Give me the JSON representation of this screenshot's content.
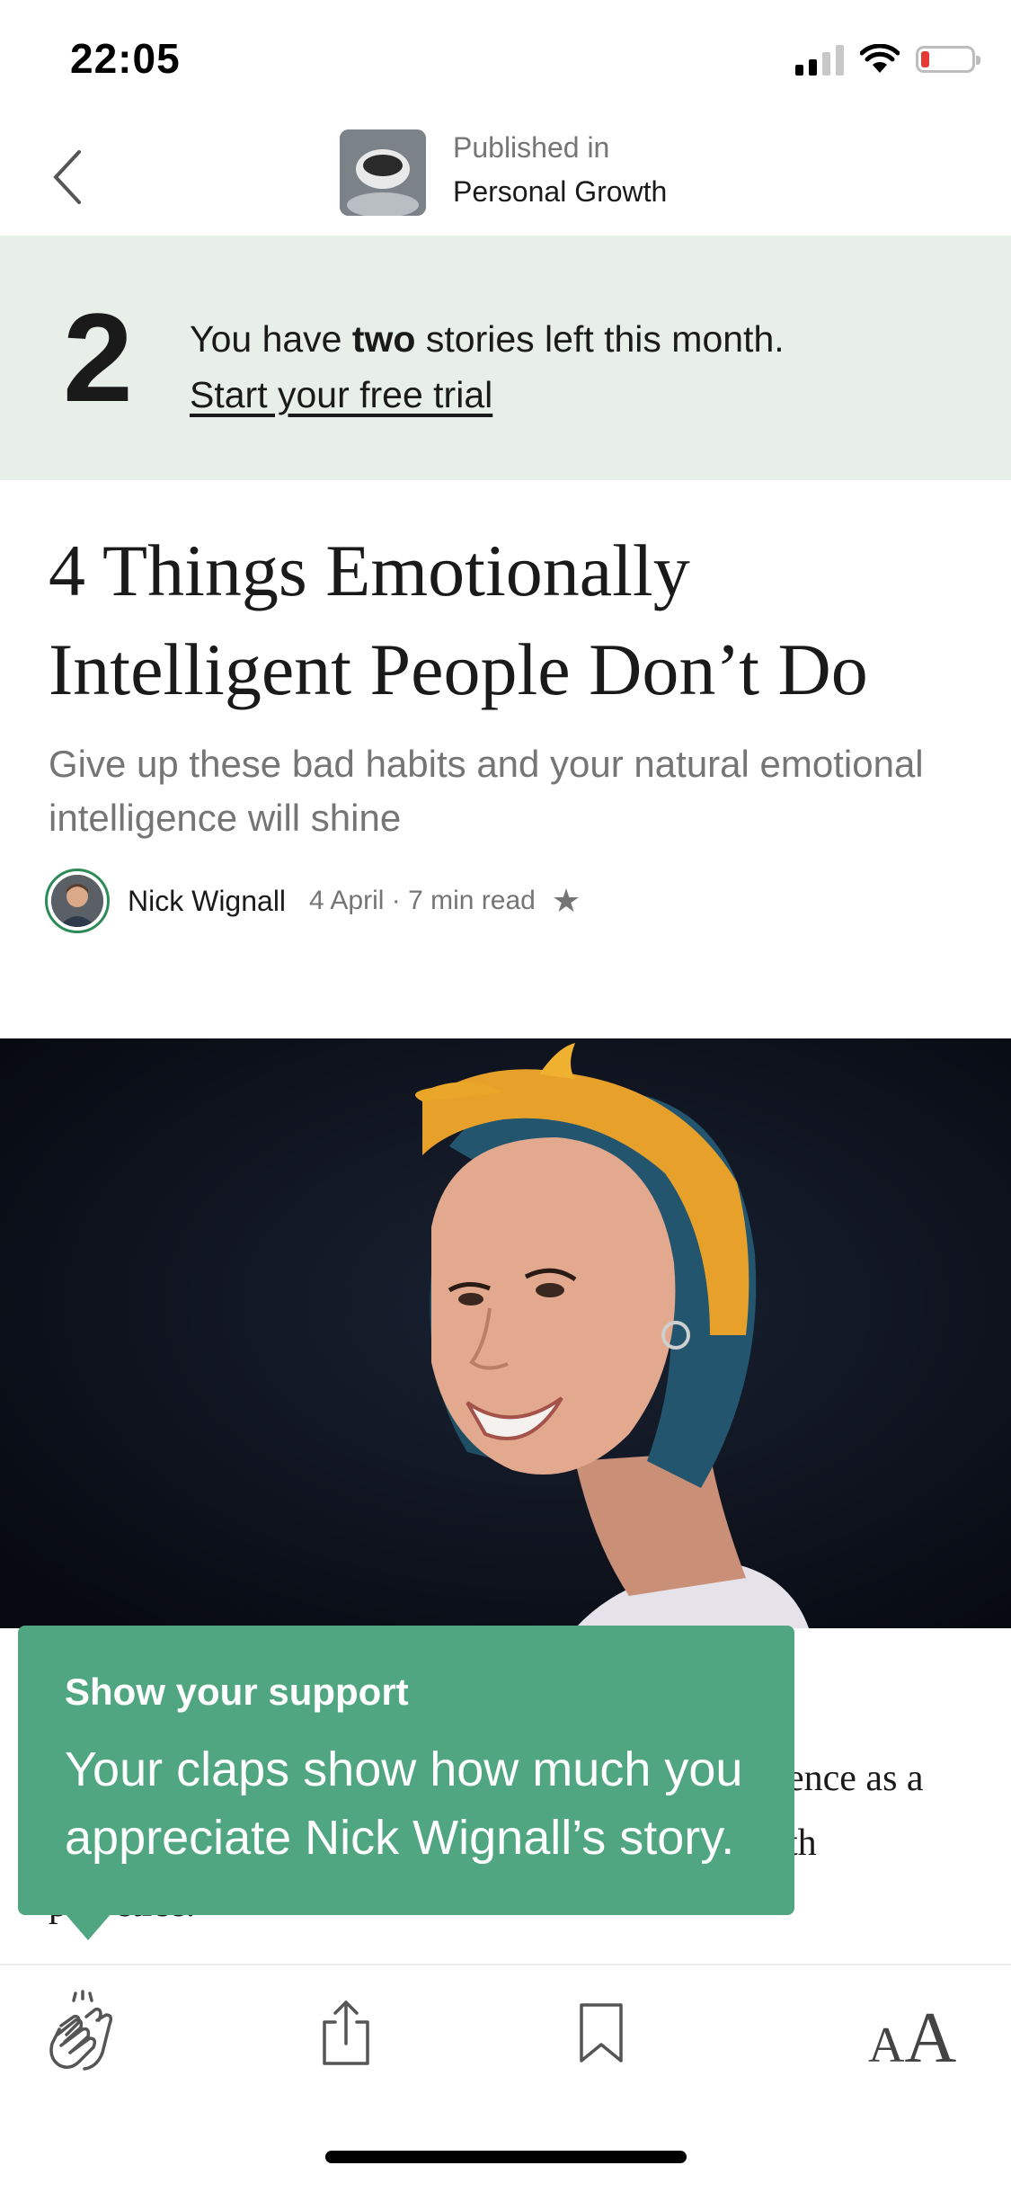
{
  "status_bar": {
    "time": "22:05"
  },
  "header": {
    "published_label": "Published in",
    "publication_name": "Personal Growth"
  },
  "paywall": {
    "count": "2",
    "message_prefix": "You have ",
    "message_bold": "two",
    "message_suffix": " stories left this month.",
    "cta": "Start your free trial"
  },
  "article": {
    "title": "4 Things Emotionally Intelligent People Don’t Do",
    "subtitle": "Give up these bad habits and your natural emotional intelligence will shine",
    "author": "Nick Wignall",
    "date": "4 April",
    "separator": "·",
    "read_time": "7 min read",
    "body_fragment_line1": "ence as a",
    "body_fragment_line2": "th",
    "body_fragment_line3": "p     ctice."
  },
  "tooltip": {
    "title": "Show your support",
    "body": "Your claps show how much you appreciate Nick Wignall’s story."
  },
  "toolbar": {
    "font_small": "A",
    "font_big": "A"
  },
  "colors": {
    "accent_green": "#4fa680",
    "banner_bg": "#e8efe9",
    "battery_low": "#e53935"
  }
}
